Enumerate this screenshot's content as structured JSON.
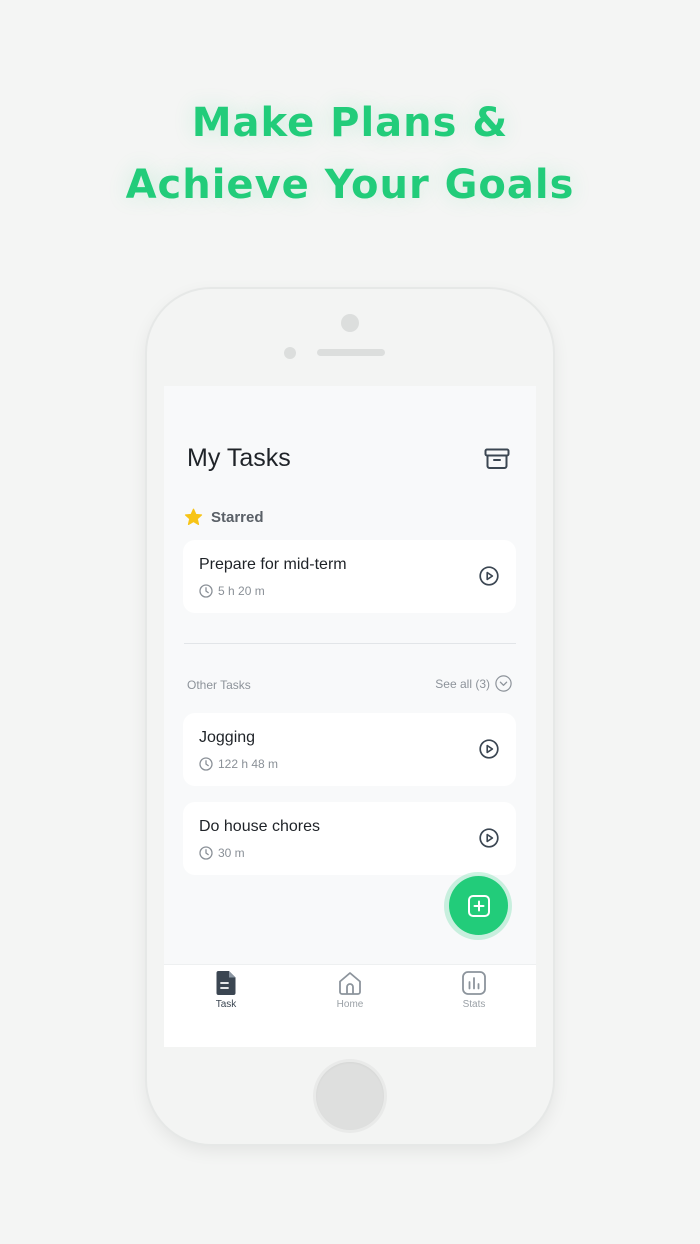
{
  "promo": {
    "line1": "Make Plans &",
    "line2": "Achieve Your Goals"
  },
  "header": {
    "title": "My Tasks"
  },
  "starred": {
    "label": "Starred",
    "tasks": [
      {
        "name": "Prepare for mid-term",
        "duration": "5 h 20 m"
      }
    ]
  },
  "other": {
    "label": "Other Tasks",
    "see_all": "See all (3)",
    "tasks": [
      {
        "name": "Jogging",
        "duration": "122 h 48 m"
      },
      {
        "name": "Do house chores",
        "duration": "30 m"
      }
    ]
  },
  "tabs": [
    {
      "label": "Task",
      "icon": "document-icon",
      "active": true
    },
    {
      "label": "Home",
      "icon": "home-icon",
      "active": false
    },
    {
      "label": "Stats",
      "icon": "bar-chart-icon",
      "active": false
    }
  ],
  "colors": {
    "accent": "#22cc7a",
    "star": "#f7c416",
    "icon": "#3b4652"
  }
}
